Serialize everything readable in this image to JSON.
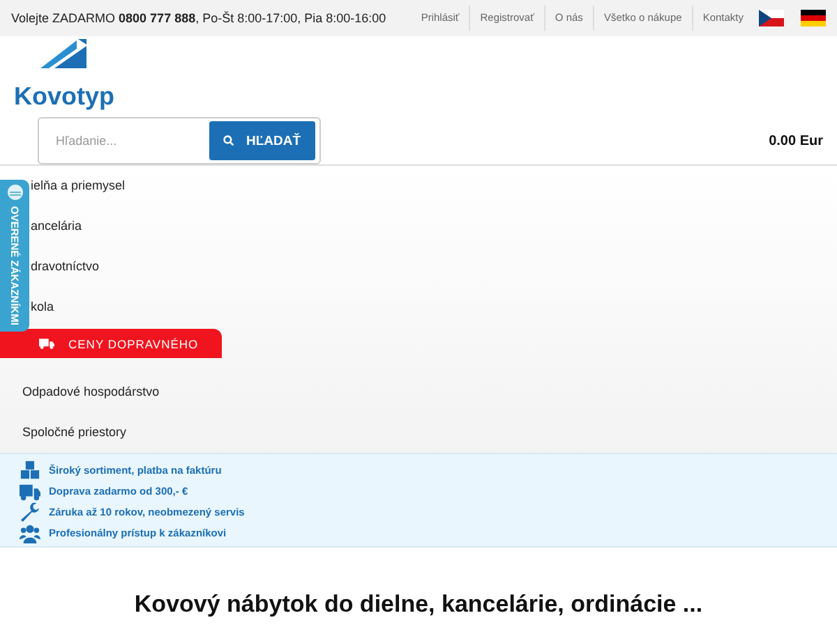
{
  "top_bar": {
    "phone_text": "Volejte ZADARMO **0800 777 888**, Po-Št 8:00-17:00, Pia 8:00-16:00",
    "links": [
      "Prihlásiť",
      "Registrovať",
      "O nás",
      "Všetko o nákupe",
      "Kontakty"
    ],
    "languages": [
      {
        "kind": "cz"
      },
      {
        "kind": "de"
      }
    ]
  },
  "header": {
    "logo": "Kovotyp",
    "search": {
      "placeholder": "Hľadanie...",
      "button": "HĽADAŤ"
    },
    "cart": "0.00 Eur"
  },
  "menu": {
    "items_before": [
      "ielňa a priemysel",
      "ancelária",
      "dravotníctvo",
      "kola"
    ],
    "banner": "CENY DOPRAVNÉHO",
    "items_after": [
      "Odpadové hospodárstvo",
      "Spoločné priestory"
    ]
  },
  "side_tab": "OVERENÉ ZÁKAZNÍKMI",
  "benefits": [
    {
      "kind": "boxes",
      "text": "Široký sortiment, platba na faktúru"
    },
    {
      "kind": "truck",
      "text": "Doprava zadarmo od 300,- €"
    },
    {
      "kind": "wrench",
      "text": "Záruka až 10 rokov, neobmezený servis"
    },
    {
      "kind": "people",
      "text": "Profesionálny prístup k zákazníkovi"
    }
  ],
  "headline": "Kovový nábytok do dielne, kancelárie, ordinácie ..."
}
